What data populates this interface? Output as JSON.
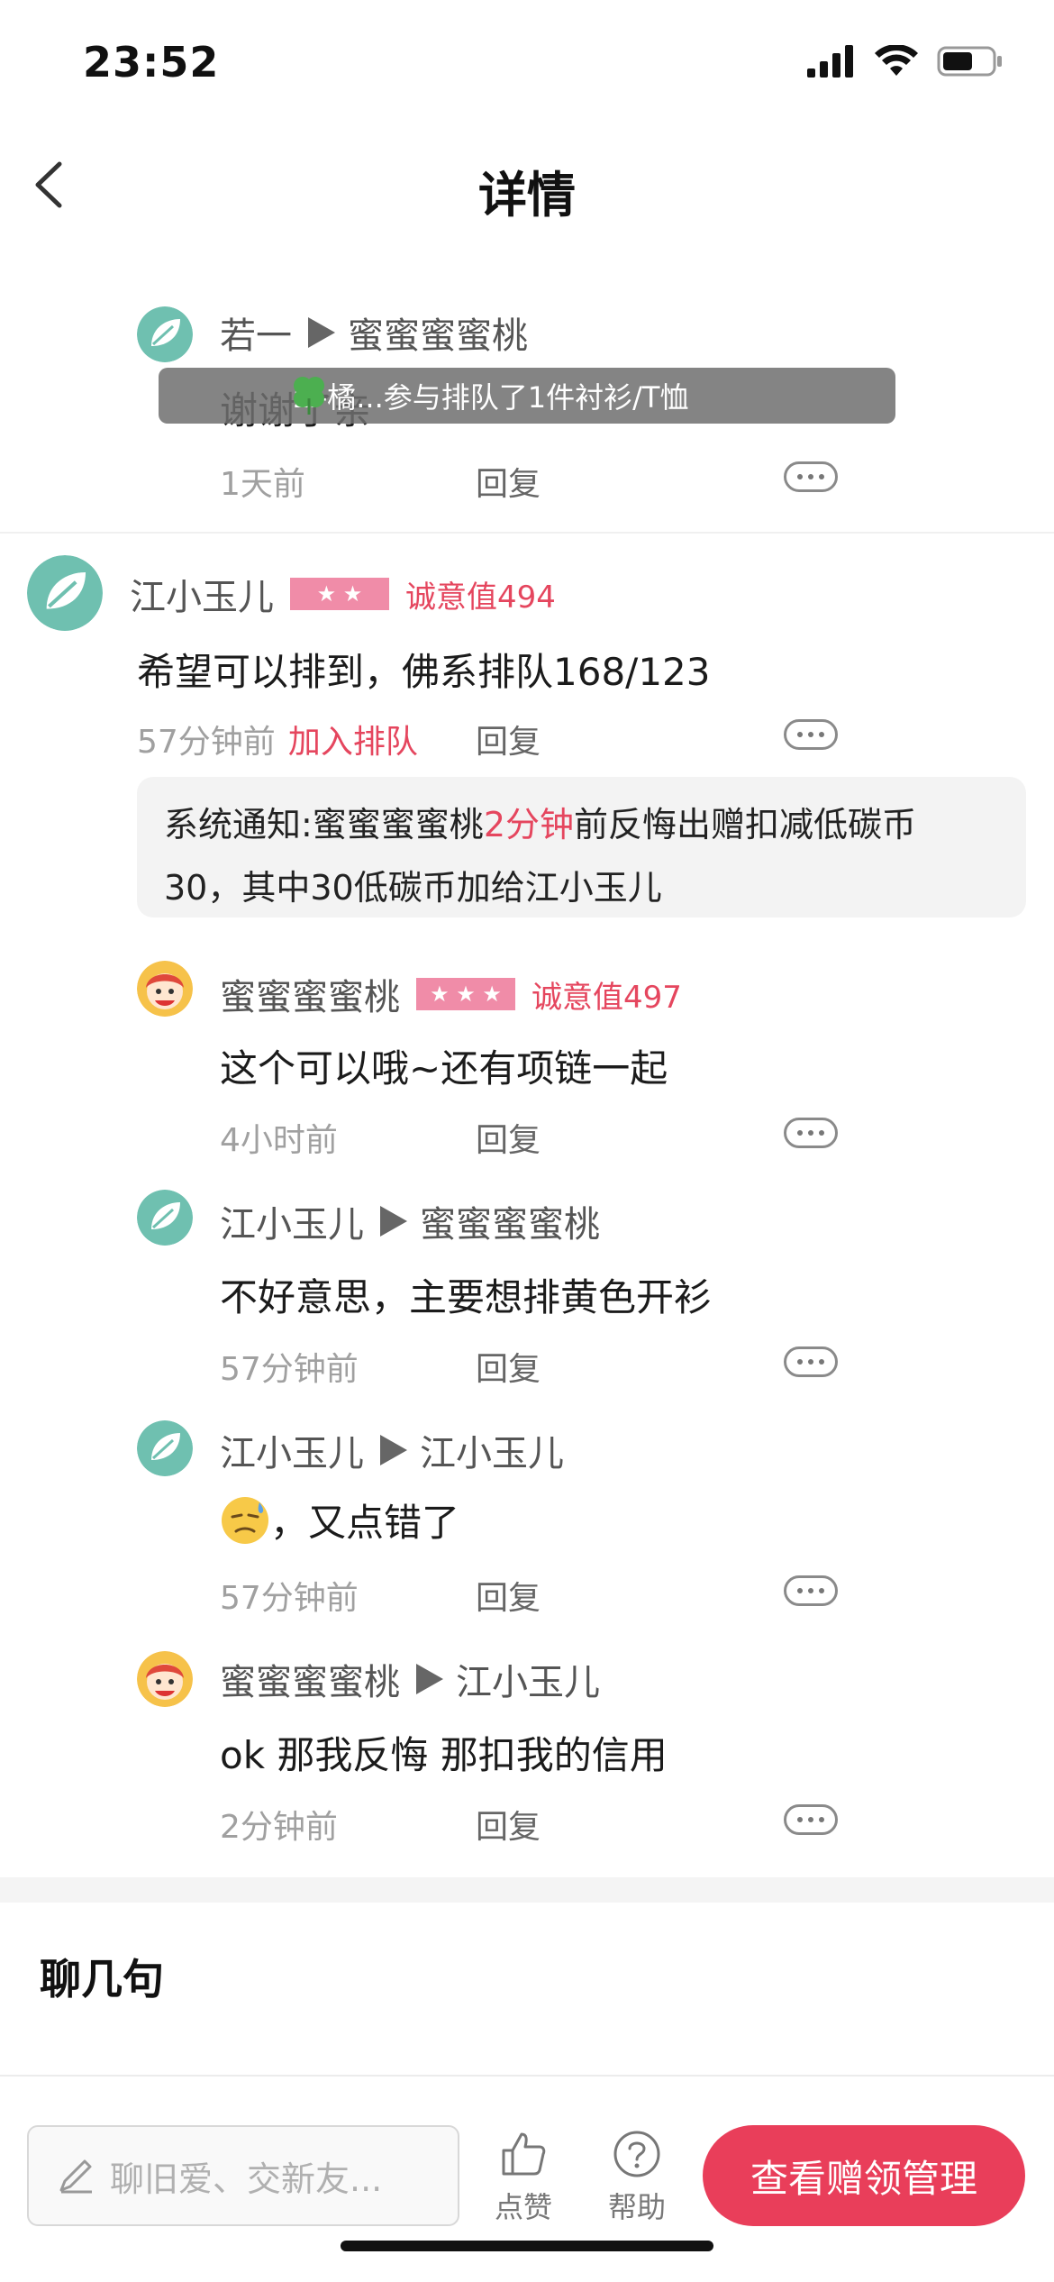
{
  "status_bar": {
    "time": "23:52"
  },
  "nav": {
    "title": "详情"
  },
  "toast": {
    "text": "zi-橘...参与排队了1件衬衫/T恤"
  },
  "comments": [
    {
      "user": "若一",
      "target": "蜜蜜蜜蜜桃",
      "content": "谢谢了亲",
      "time": "1天前",
      "reply": "回复"
    },
    {
      "user": "江小玉儿",
      "score": "诚意值494",
      "content": "希望可以排到，佛系排队168/123",
      "time": "57分钟前",
      "join": "加入排队",
      "reply": "回复"
    },
    {
      "user": "蜜蜜蜜蜜桃",
      "score": "诚意值497",
      "content": "这个可以哦~还有项链一起",
      "time": "4小时前",
      "reply": "回复"
    },
    {
      "user": "江小玉儿",
      "target": "蜜蜜蜜蜜桃",
      "content": "不好意思，主要想排黄色开衫",
      "time": "57分钟前",
      "reply": "回复"
    },
    {
      "user": "江小玉儿",
      "target": "江小玉儿",
      "content": "，又点错了",
      "time": "57分钟前",
      "reply": "回复"
    },
    {
      "user": "蜜蜜蜜蜜桃",
      "target": "江小玉儿",
      "content": "ok 那我反悔 那扣我的信用",
      "time": "2分钟前",
      "reply": "回复"
    }
  ],
  "notice": {
    "prefix": "系统通知:蜜蜜蜜蜜桃",
    "highlight": "2分钟",
    "suffix_line1": "前反悔出赠扣减低碳币",
    "line2": "30，其中30低碳币加给江小玉儿"
  },
  "chat_section": {
    "title": "聊几句"
  },
  "bottom_bar": {
    "input_placeholder": "聊旧爱、交新友...",
    "like_label": "点赞",
    "help_label": "帮助",
    "cta_label": "查看赠领管理"
  },
  "colors": {
    "accent": "#e93e5a",
    "badge": "#f08ca8",
    "score": "#e5465e"
  }
}
